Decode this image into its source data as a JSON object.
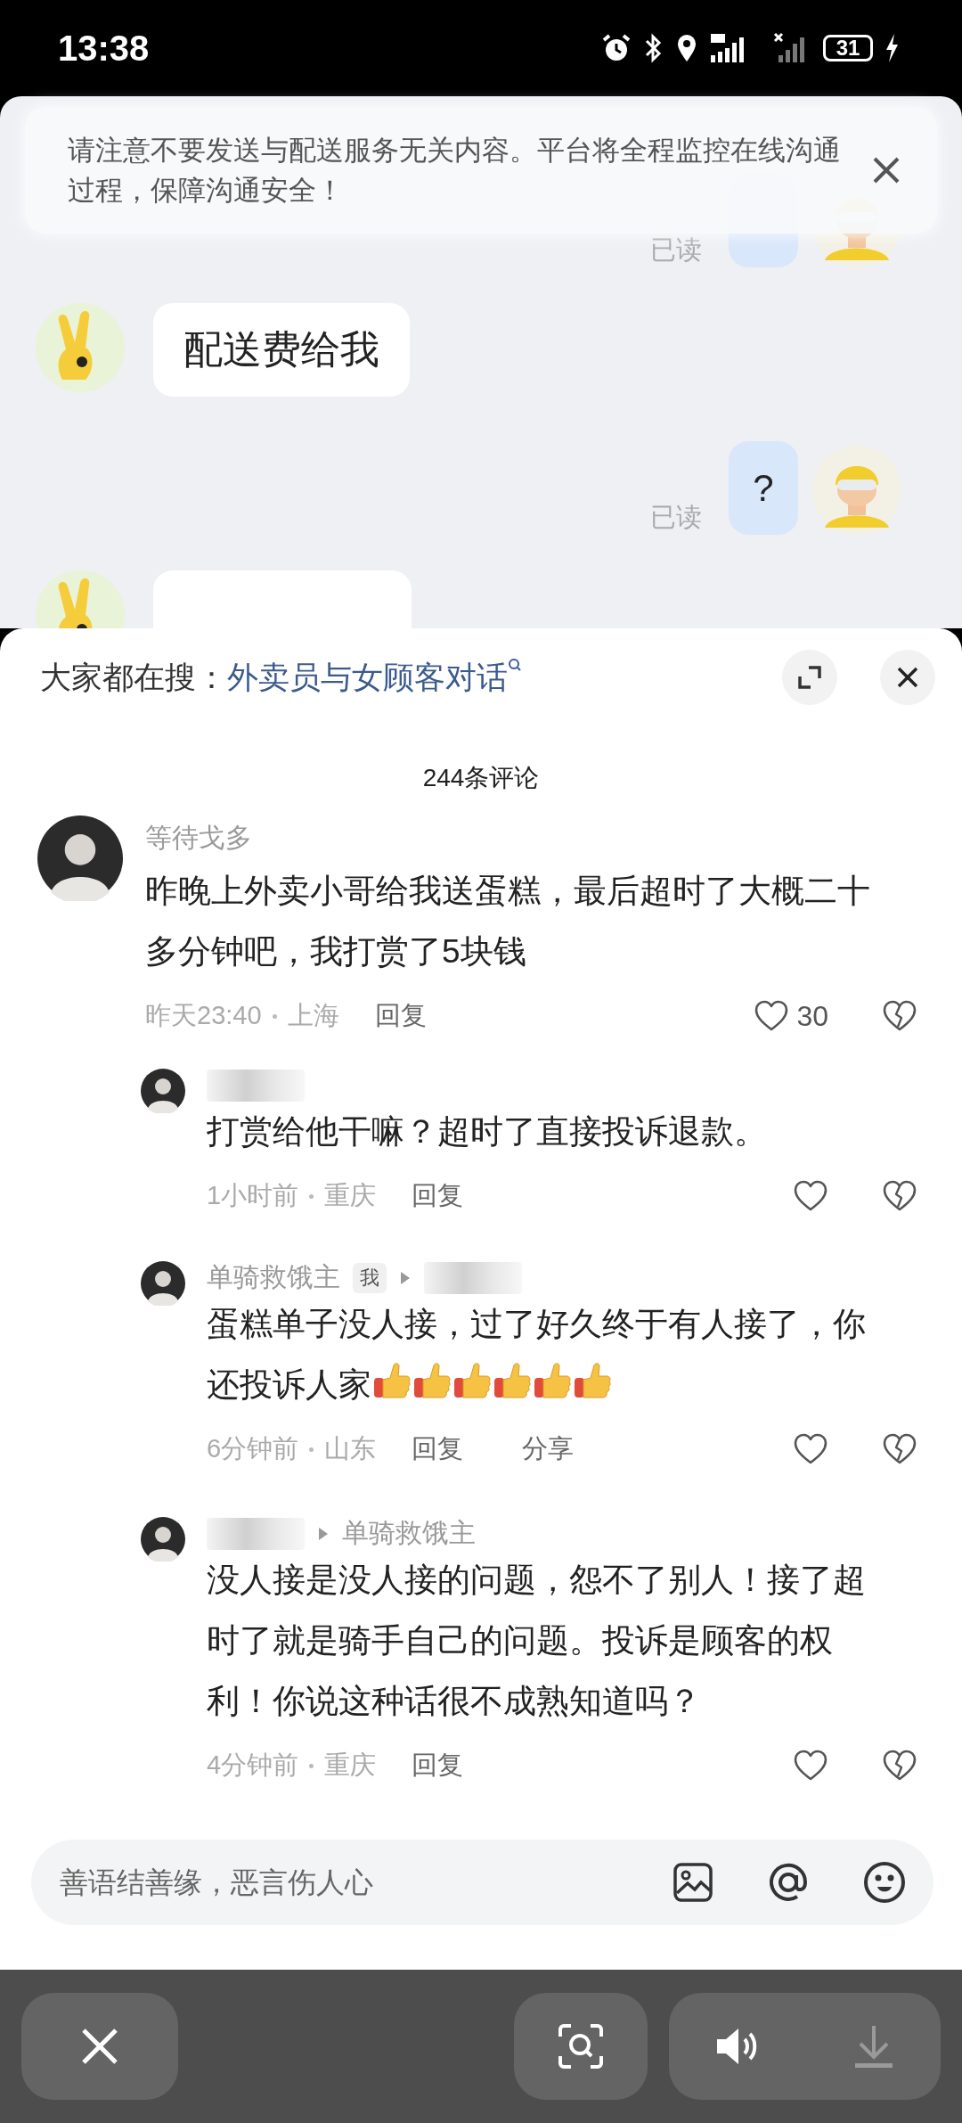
{
  "status_bar": {
    "time": "13:38",
    "battery": "31"
  },
  "chat": {
    "notice": "请注意不要发送与配送服务无关内容。平台将全程监控在线沟通过程，保障沟通安全！",
    "messages": [
      {
        "kind": "outgoing",
        "status": "已读"
      },
      {
        "kind": "incoming",
        "text": "配送费给我"
      },
      {
        "kind": "outgoing",
        "text": "?",
        "status": "已读"
      },
      {
        "kind": "incoming"
      }
    ]
  },
  "comments_panel": {
    "search_label": "大家都在搜：",
    "search_query": "外卖员与女顾客对话",
    "count": "244条评论",
    "comments": [
      {
        "name": "等待戈多",
        "name_hidden": false,
        "text": "昨晚上外卖小哥给我送蛋糕，最后超时了大概二十多分钟吧，我打赏了5块钱",
        "time": "昨天23:40",
        "location": "上海",
        "reply_label": "回复",
        "likes": "30",
        "children": [
          {
            "name_hidden": true,
            "reply_to_hidden": false,
            "text": "打赏给他干嘛？超时了直接投诉退款。",
            "time": "1小时前",
            "location": "重庆",
            "reply_label": "回复"
          },
          {
            "name": "单骑救饿主",
            "name_hidden": false,
            "tag": "我",
            "reply_to_hidden": true,
            "text": "蛋糕单子没人接，过了好久终于有人接了，你还投诉人家",
            "emojis": [
              {
                "kind": "thumbs-up"
              },
              {
                "kind": "thumbs-up"
              },
              {
                "kind": "thumbs-up"
              },
              {
                "kind": "thumbs-up"
              },
              {
                "kind": "thumbs-up"
              },
              {
                "kind": "thumbs-up"
              }
            ],
            "time": "6分钟前",
            "location": "山东",
            "reply_label": "回复",
            "share_label": "分享"
          },
          {
            "name_hidden": true,
            "reply_to": "单骑救饿主",
            "reply_to_hidden": false,
            "text": "没人接是没人接的问题，怨不了别人！接了超时了就是骑手自己的问题。投诉是顾客的权利！你说这种话很不成熟知道吗？",
            "time": "4分钟前",
            "location": "重庆",
            "reply_label": "回复"
          }
        ]
      }
    ],
    "input": {
      "placeholder": "善语结善缘，恶言伤人心"
    }
  },
  "bottom_bar": {
    "buttons": [
      {
        "kind": "close"
      },
      {
        "kind": "scan"
      },
      {
        "kind": "group",
        "items": [
          {
            "kind": "sound",
            "disabled": false
          },
          {
            "kind": "download",
            "disabled": true
          }
        ]
      }
    ]
  }
}
